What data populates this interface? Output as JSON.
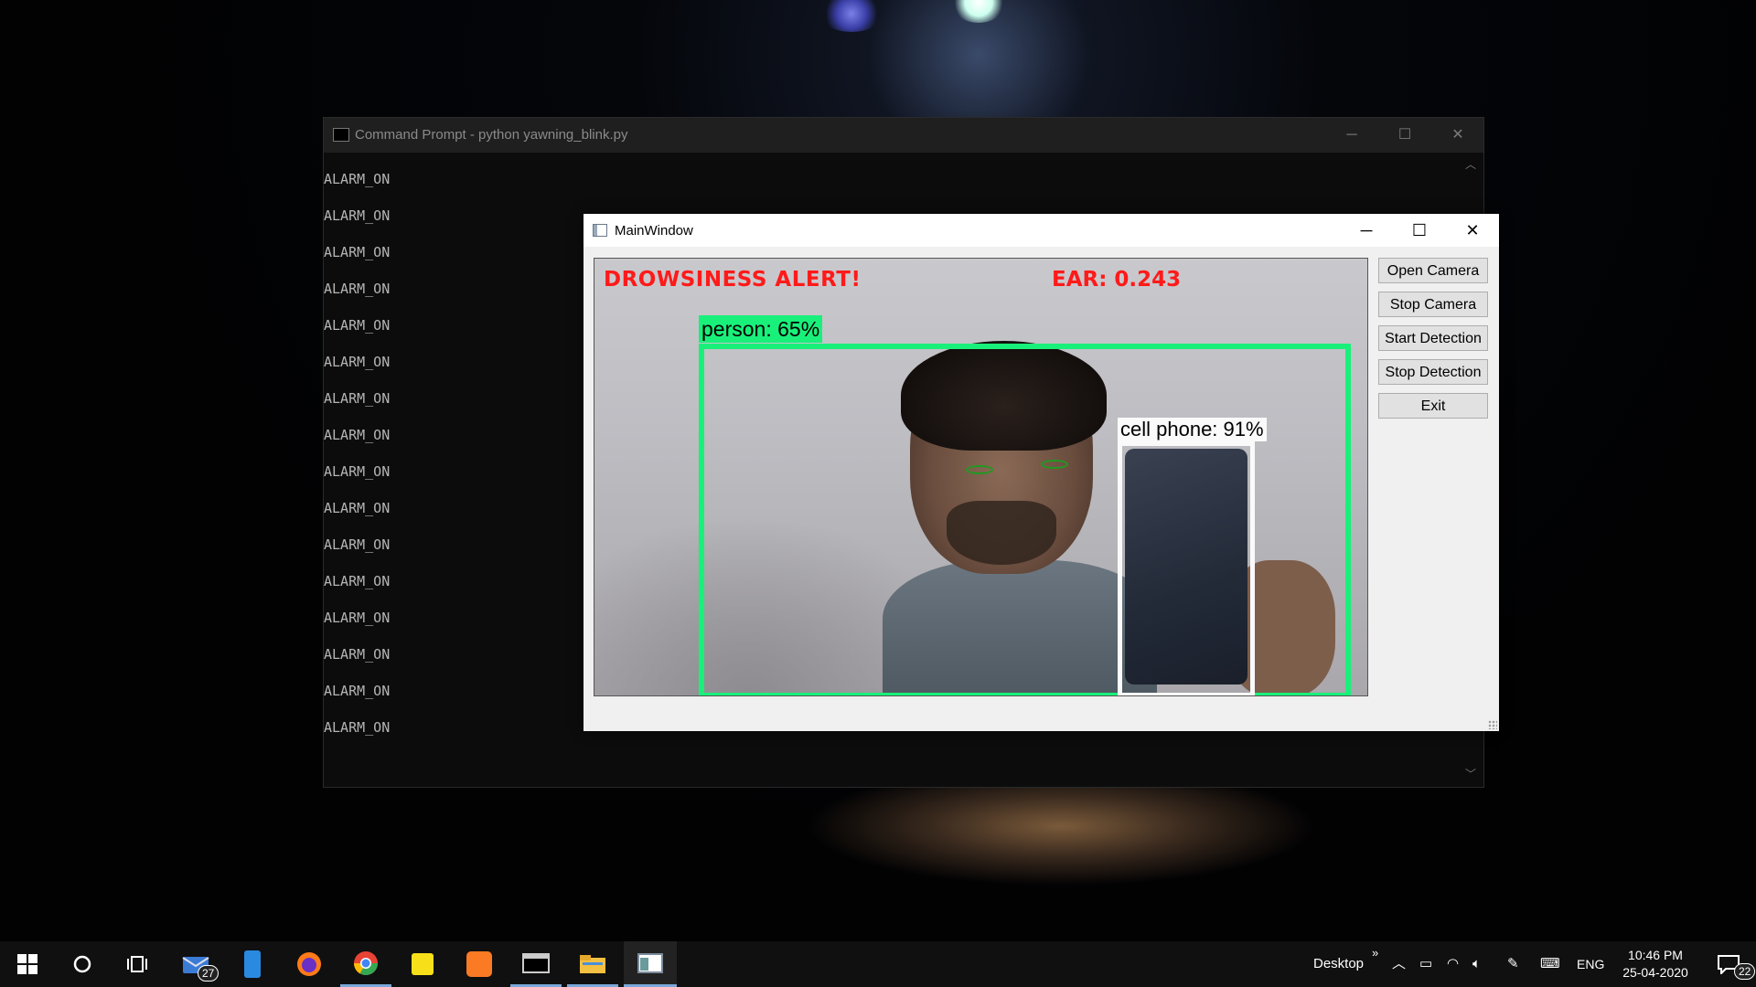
{
  "cmd": {
    "title": "Command Prompt - python  yawning_blink.py",
    "lines": [
      "ALARM_ON",
      "ALARM_ON",
      "ALARM_ON",
      "ALARM_ON",
      "ALARM_ON",
      "ALARM_ON",
      "ALARM_ON",
      "ALARM_ON",
      "ALARM_ON",
      "ALARM_ON",
      "ALARM_ON",
      "ALARM_ON",
      "ALARM_ON",
      "ALARM_ON",
      "ALARM_ON",
      "ALARM_ON"
    ],
    "minimize": "─",
    "maximize": "☐",
    "close": "✕"
  },
  "main": {
    "title": "MainWindow",
    "minimize": "─",
    "maximize": "☐",
    "close": "✕",
    "video": {
      "alert": "DROWSINESS ALERT!",
      "ear": "EAR: 0.243",
      "person_label": "person: 65%",
      "phone_label": "cell phone: 91%",
      "person_confidence": 0.65,
      "phone_confidence": 0.91
    },
    "buttons": {
      "open_camera": "Open Camera",
      "stop_camera": "Stop Camera",
      "start_detection": "Start Detection",
      "stop_detection": "Stop Detection",
      "exit": "Exit"
    }
  },
  "taskbar": {
    "mail_badge": "27",
    "desktop_label": "Desktop",
    "chevron": "»",
    "language": "ENG",
    "time": "10:46 PM",
    "date": "25-04-2020",
    "notification_count": "22",
    "icons": [
      "windows-start-icon",
      "cortana-icon",
      "task-view-icon",
      "mail-icon",
      "phone-icon",
      "firefox-icon",
      "chrome-icon",
      "sticky-notes-icon",
      "xampp-icon",
      "terminal-icon",
      "file-explorer-icon",
      "mainwindow-app-icon"
    ]
  },
  "colors": {
    "alert_red": "#ff1a1a",
    "person_box": "#19f07a",
    "phone_box": "#fafafa",
    "cmd_bg": "#0c0c0c"
  }
}
